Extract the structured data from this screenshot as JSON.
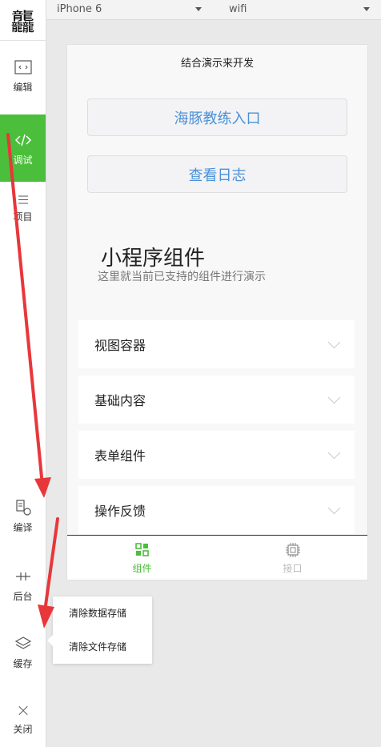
{
  "toolbar": {
    "logo_text": "龘",
    "items": [
      {
        "label": "编辑",
        "icon": "code-window-icon"
      },
      {
        "label": "调试",
        "icon": "code-brackets-icon"
      },
      {
        "label": "项目",
        "icon": "menu-lines-icon"
      },
      {
        "label": "编译",
        "icon": "compile-refresh-icon"
      },
      {
        "label": "后台",
        "icon": "background-pipe-icon"
      },
      {
        "label": "缓存",
        "icon": "layers-icon"
      },
      {
        "label": "关闭",
        "icon": "close-icon"
      }
    ]
  },
  "topbar": {
    "device": "iPhone 6",
    "network": "wifi"
  },
  "page": {
    "nav_title": "结合演示来开发",
    "buttons": [
      "海豚教练入口",
      "查看日志"
    ],
    "section_title": "小程序组件",
    "section_subtitle": "这里就当前已支持的组件进行演示",
    "rows": [
      "视图容器",
      "基础内容",
      "表单组件",
      "操作反馈"
    ],
    "tabs": [
      {
        "label": "组件",
        "icon": "grid-icon"
      },
      {
        "label": "接口",
        "icon": "chip-icon"
      }
    ]
  },
  "cache_menu": {
    "items": [
      "清除数据存储",
      "清除文件存储"
    ]
  },
  "colors": {
    "accent_green": "#4bbe3b",
    "link_blue": "#4a90d9",
    "arrow_red": "#e8373a"
  }
}
